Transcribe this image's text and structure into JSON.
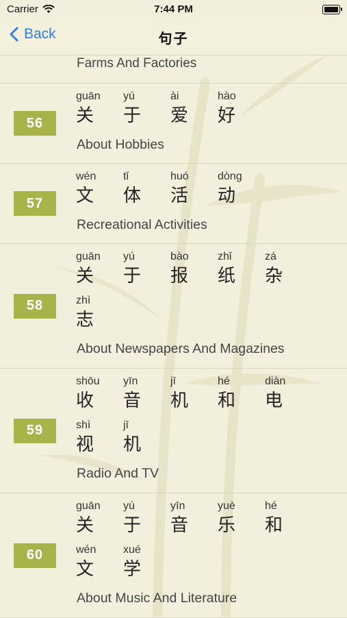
{
  "status_bar": {
    "carrier": "Carrier",
    "time": "7:44 PM"
  },
  "nav": {
    "back_label": "Back",
    "title": "句子"
  },
  "list": {
    "partial_title": "Farms And Factories",
    "lessons": [
      {
        "number": "56",
        "chars": [
          {
            "pinyin": "guān",
            "hanzi": "关"
          },
          {
            "pinyin": "yú",
            "hanzi": "于"
          },
          {
            "pinyin": "ài",
            "hanzi": "爱"
          },
          {
            "pinyin": "hào",
            "hanzi": "好"
          }
        ],
        "title": "About Hobbies"
      },
      {
        "number": "57",
        "chars": [
          {
            "pinyin": "wén",
            "hanzi": "文"
          },
          {
            "pinyin": "tǐ",
            "hanzi": "体"
          },
          {
            "pinyin": "huó",
            "hanzi": "活"
          },
          {
            "pinyin": "dòng",
            "hanzi": "动"
          }
        ],
        "title": "Recreational Activities"
      },
      {
        "number": "58",
        "chars": [
          {
            "pinyin": "guān",
            "hanzi": "关"
          },
          {
            "pinyin": "yú",
            "hanzi": "于"
          },
          {
            "pinyin": "bào",
            "hanzi": "报"
          },
          {
            "pinyin": "zhǐ",
            "hanzi": "纸"
          },
          {
            "pinyin": "zá",
            "hanzi": "杂"
          },
          {
            "pinyin": "zhì",
            "hanzi": "志"
          }
        ],
        "title": "About Newspapers And Magazines"
      },
      {
        "number": "59",
        "chars": [
          {
            "pinyin": "shōu",
            "hanzi": "收"
          },
          {
            "pinyin": "yīn",
            "hanzi": "音"
          },
          {
            "pinyin": "jī",
            "hanzi": "机"
          },
          {
            "pinyin": "hé",
            "hanzi": "和"
          },
          {
            "pinyin": "diàn",
            "hanzi": "电"
          },
          {
            "pinyin": "shì",
            "hanzi": "视"
          },
          {
            "pinyin": "jī",
            "hanzi": "机"
          }
        ],
        "title": "Radio And TV"
      },
      {
        "number": "60",
        "chars": [
          {
            "pinyin": "guān",
            "hanzi": "关"
          },
          {
            "pinyin": "yú",
            "hanzi": "于"
          },
          {
            "pinyin": "yīn",
            "hanzi": "音"
          },
          {
            "pinyin": "yuè",
            "hanzi": "乐"
          },
          {
            "pinyin": "hé",
            "hanzi": "和"
          },
          {
            "pinyin": "wén",
            "hanzi": "文"
          },
          {
            "pinyin": "xué",
            "hanzi": "学"
          }
        ],
        "title": "About Music And Literature"
      }
    ]
  },
  "colors": {
    "accent": "#2f7cf6",
    "badge": "#a8b44a",
    "background": "#f2f0dc"
  }
}
